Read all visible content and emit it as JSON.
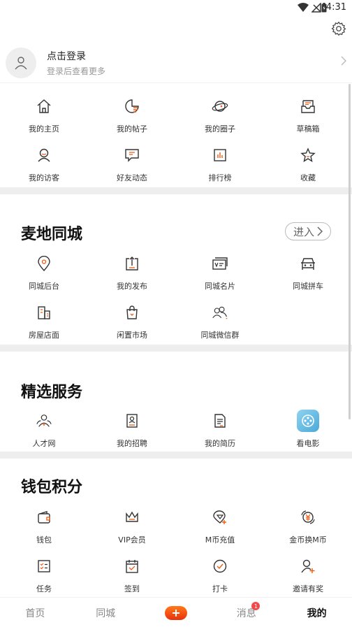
{
  "status_bar": {
    "time": "4:31"
  },
  "profile": {
    "title": "点击登录",
    "subtitle": "登录后查看更多"
  },
  "quick_grid": [
    [
      {
        "label": "我的主页",
        "icon": "home-icon"
      },
      {
        "label": "我的帖子",
        "icon": "post-icon"
      },
      {
        "label": "我的圈子",
        "icon": "planet-icon"
      },
      {
        "label": "草稿箱",
        "icon": "drafts-icon"
      }
    ],
    [
      {
        "label": "我的访客",
        "icon": "visitor-icon"
      },
      {
        "label": "好友动态",
        "icon": "chat-icon"
      },
      {
        "label": "排行榜",
        "icon": "chart-icon"
      },
      {
        "label": "收藏",
        "icon": "star-icon"
      }
    ]
  ],
  "city_section": {
    "title": "麦地同城",
    "enter_label": "进入",
    "rows": [
      [
        {
          "label": "同城后台",
          "icon": "location-icon"
        },
        {
          "label": "我的发布",
          "icon": "publish-icon"
        },
        {
          "label": "同城名片",
          "icon": "card-icon"
        },
        {
          "label": "同城拼车",
          "icon": "car-icon"
        }
      ],
      [
        {
          "label": "房屋店面",
          "icon": "building-icon"
        },
        {
          "label": "闲置市场",
          "icon": "bag-icon"
        },
        {
          "label": "同城微信群",
          "icon": "group-icon"
        }
      ]
    ]
  },
  "services_section": {
    "title": "精选服务",
    "items": [
      {
        "label": "人才网",
        "icon": "people-icon"
      },
      {
        "label": "我的招聘",
        "icon": "resume-icon"
      },
      {
        "label": "我的简历",
        "icon": "document-icon"
      },
      {
        "label": "看电影",
        "icon": "film-icon"
      }
    ]
  },
  "wallet_section": {
    "title": "钱包积分",
    "rows": [
      [
        {
          "label": "钱包",
          "icon": "wallet-icon"
        },
        {
          "label": "VIP会员",
          "icon": "crown-icon"
        },
        {
          "label": "M币充值",
          "icon": "diamond-icon"
        },
        {
          "label": "金币换M币",
          "icon": "coin-icon"
        }
      ],
      [
        {
          "label": "任务",
          "icon": "task-icon"
        },
        {
          "label": "签到",
          "icon": "calendar-icon"
        },
        {
          "label": "打卡",
          "icon": "check-icon"
        },
        {
          "label": "邀请有奖",
          "icon": "invite-icon"
        }
      ]
    ]
  },
  "tab_bar": {
    "tabs": [
      {
        "label": "首页"
      },
      {
        "label": "同城"
      },
      {
        "label": ""
      },
      {
        "label": "消息",
        "badge": "1"
      },
      {
        "label": "我的"
      }
    ],
    "active_index": 4,
    "accent": "#f05a14"
  }
}
